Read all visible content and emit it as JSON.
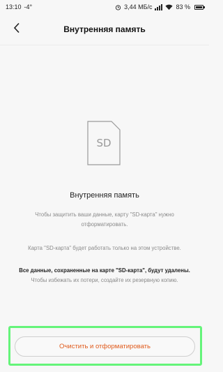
{
  "status_bar": {
    "time": "13:10",
    "weather": "-4°",
    "network_speed": "3,44 МБ/с",
    "battery_percent": "83 %",
    "battery_level": 0.83,
    "icons": [
      "alarm-icon",
      "signal-icon",
      "wifi-icon",
      "battery-icon"
    ]
  },
  "header": {
    "title": "Внутренняя память",
    "back_icon": "chevron-left-icon"
  },
  "illustration": {
    "icon": "sd-card-icon",
    "label": "SD"
  },
  "content": {
    "title": "Внутренняя память",
    "paragraph1": "Чтобы защитить ваши данные, карту \"SD-карта\" нужно отформатировать.",
    "paragraph2": "Карта \"SD-карта\" будет работать только на этом устройстве.",
    "paragraph3_bold": "Все данные, сохраненные на карте \"SD-карта\", будут удалены.",
    "paragraph3_rest": "Чтобы избежать их потери, создайте их резервную копию."
  },
  "action": {
    "button_label": "Очистить и отформатировать",
    "accent_color": "#e05a1b",
    "highlight_color": "#65f47a"
  }
}
